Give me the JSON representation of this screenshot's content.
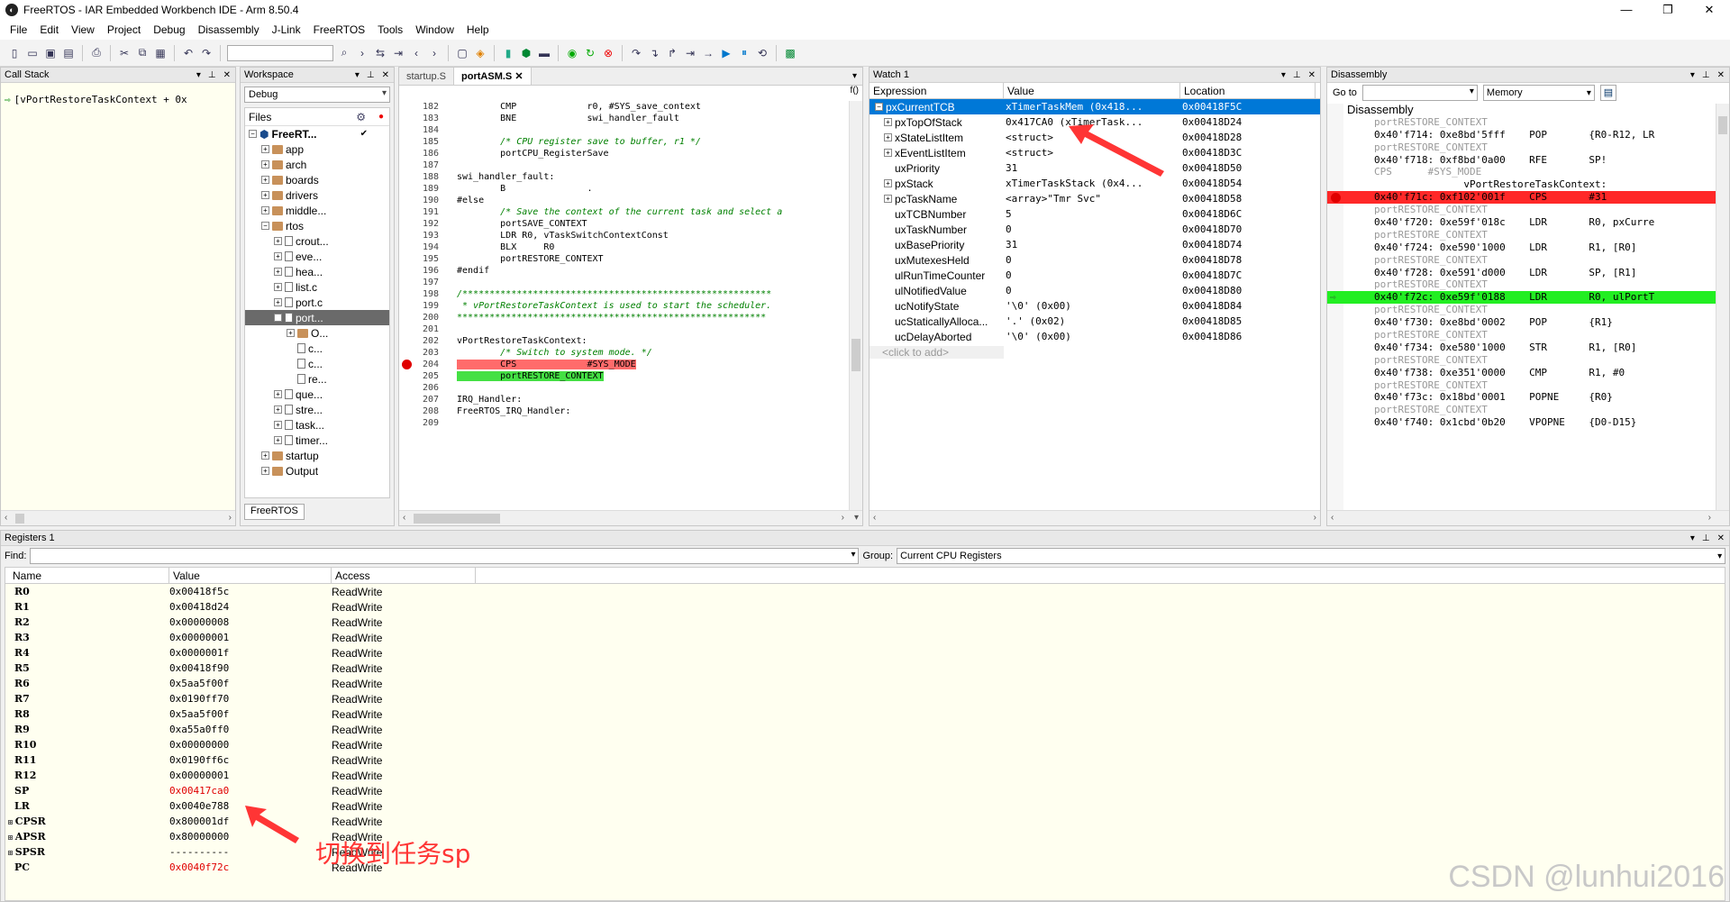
{
  "window": {
    "title": "FreeRTOS - IAR Embedded Workbench IDE - Arm 8.50.4"
  },
  "menu": [
    "File",
    "Edit",
    "View",
    "Project",
    "Debug",
    "Disassembly",
    "J-Link",
    "FreeRTOS",
    "Tools",
    "Window",
    "Help"
  ],
  "callstack": {
    "title": "Call Stack",
    "entry": "[vPortRestoreTaskContext + 0x"
  },
  "workspace": {
    "title": "Workspace",
    "config": "Debug",
    "files_header": "Files",
    "tab": "FreeRTOS",
    "tree": [
      {
        "label": "FreeRT...",
        "level": 0,
        "type": "proj",
        "exp": "⊟"
      },
      {
        "label": "app",
        "level": 1,
        "type": "folder",
        "exp": "⊞"
      },
      {
        "label": "arch",
        "level": 1,
        "type": "folder",
        "exp": "⊞"
      },
      {
        "label": "boards",
        "level": 1,
        "type": "folder",
        "exp": "⊞"
      },
      {
        "label": "drivers",
        "level": 1,
        "type": "folder",
        "exp": "⊞"
      },
      {
        "label": "middle...",
        "level": 1,
        "type": "folder",
        "exp": "⊞"
      },
      {
        "label": "rtos",
        "level": 1,
        "type": "folder",
        "exp": "⊟"
      },
      {
        "label": "crout...",
        "level": 2,
        "type": "file",
        "exp": "⊞"
      },
      {
        "label": "eve...",
        "level": 2,
        "type": "file",
        "exp": "⊞"
      },
      {
        "label": "hea...",
        "level": 2,
        "type": "file",
        "exp": "⊞"
      },
      {
        "label": "list.c",
        "level": 2,
        "type": "file",
        "exp": "⊞"
      },
      {
        "label": "port.c",
        "level": 2,
        "type": "file",
        "exp": "⊞"
      },
      {
        "label": "port...",
        "level": 2,
        "type": "file",
        "exp": "⊟",
        "sel": true
      },
      {
        "label": "O...",
        "level": 3,
        "type": "folder",
        "exp": "⊞"
      },
      {
        "label": "c...",
        "level": 3,
        "type": "file",
        "exp": ""
      },
      {
        "label": "c...",
        "level": 3,
        "type": "file",
        "exp": ""
      },
      {
        "label": "re...",
        "level": 3,
        "type": "file",
        "exp": ""
      },
      {
        "label": "que...",
        "level": 2,
        "type": "file",
        "exp": "⊞"
      },
      {
        "label": "stre...",
        "level": 2,
        "type": "file",
        "exp": "⊞"
      },
      {
        "label": "task...",
        "level": 2,
        "type": "file",
        "exp": "⊞"
      },
      {
        "label": "timer...",
        "level": 2,
        "type": "file",
        "exp": "⊞"
      },
      {
        "label": "startup",
        "level": 1,
        "type": "folder",
        "exp": "⊞"
      },
      {
        "label": "Output",
        "level": 1,
        "type": "folder",
        "exp": "⊞"
      }
    ]
  },
  "editor": {
    "tabs": [
      "startup.S",
      "portASM.S"
    ],
    "active_tab": "portASM.S",
    "func_glyph": "f()",
    "lines": [
      {
        "n": "182",
        "t": "        CMP             r0, #SYS_save_context"
      },
      {
        "n": "183",
        "t": "        BNE             swi_handler_fault"
      },
      {
        "n": "184",
        "t": ""
      },
      {
        "n": "185",
        "t": "        /* CPU register save to buffer, r1 */",
        "c": true
      },
      {
        "n": "186",
        "t": "        portCPU_RegisterSave"
      },
      {
        "n": "187",
        "t": ""
      },
      {
        "n": "188",
        "t": "swi_handler_fault:"
      },
      {
        "n": "189",
        "t": "        B               ."
      },
      {
        "n": "190",
        "t": "#else"
      },
      {
        "n": "191",
        "t": "        /* Save the context of the current task and select a",
        "c": true
      },
      {
        "n": "192",
        "t": "        portSAVE_CONTEXT"
      },
      {
        "n": "193",
        "t": "        LDR R0, vTaskSwitchContextConst"
      },
      {
        "n": "194",
        "t": "        BLX     R0"
      },
      {
        "n": "195",
        "t": "        portRESTORE_CONTEXT"
      },
      {
        "n": "196",
        "t": "#endif"
      },
      {
        "n": "197",
        "t": ""
      },
      {
        "n": "198",
        "t": "/*********************************************************",
        "c": true
      },
      {
        "n": "199",
        "t": " * vPortRestoreTaskContext is used to start the scheduler.",
        "c": true
      },
      {
        "n": "200",
        "t": "*********************************************************",
        "c": true
      },
      {
        "n": "201",
        "t": ""
      },
      {
        "n": "202",
        "t": "vPortRestoreTaskContext:"
      },
      {
        "n": "203",
        "t": "        /* Switch to system mode. */",
        "c": true
      },
      {
        "n": "204",
        "t": "        CPS             #SYS_MODE",
        "bp": true
      },
      {
        "n": "205",
        "t": "        portRESTORE_CONTEXT",
        "cur": true
      },
      {
        "n": "206",
        "t": ""
      },
      {
        "n": "207",
        "t": "IRQ_Handler:"
      },
      {
        "n": "208",
        "t": "FreeRTOS_IRQ_Handler:"
      },
      {
        "n": "209",
        "t": ""
      }
    ]
  },
  "watch": {
    "title": "Watch 1",
    "headers": [
      "Expression",
      "Value",
      "Location"
    ],
    "rows": [
      {
        "e": "pxCurrentTCB",
        "v": "xTimerTaskMem (0x418...",
        "l": "0x00418F5C",
        "exp": "⊟",
        "lvl": 0,
        "sel": true
      },
      {
        "e": "pxTopOfStack",
        "v": "0x417CA0 (xTimerTask...",
        "l": "0x00418D24",
        "exp": "⊞",
        "lvl": 1
      },
      {
        "e": "xStateListItem",
        "v": "<struct>",
        "l": "0x00418D28",
        "exp": "⊞",
        "lvl": 1
      },
      {
        "e": "xEventListItem",
        "v": "<struct>",
        "l": "0x00418D3C",
        "exp": "⊞",
        "lvl": 1
      },
      {
        "e": "uxPriority",
        "v": "31",
        "l": "0x00418D50",
        "exp": "",
        "lvl": 1
      },
      {
        "e": "pxStack",
        "v": "xTimerTaskStack (0x4...",
        "l": "0x00418D54",
        "exp": "⊞",
        "lvl": 1
      },
      {
        "e": "pcTaskName",
        "v": "<array>\"Tmr Svc\"",
        "l": "0x00418D58",
        "exp": "⊞",
        "lvl": 1
      },
      {
        "e": "uxTCBNumber",
        "v": "5",
        "l": "0x00418D6C",
        "exp": "",
        "lvl": 1
      },
      {
        "e": "uxTaskNumber",
        "v": "0",
        "l": "0x00418D70",
        "exp": "",
        "lvl": 1
      },
      {
        "e": "uxBasePriority",
        "v": "31",
        "l": "0x00418D74",
        "exp": "",
        "lvl": 1
      },
      {
        "e": "uxMutexesHeld",
        "v": "0",
        "l": "0x00418D78",
        "exp": "",
        "lvl": 1
      },
      {
        "e": "ulRunTimeCounter",
        "v": "0",
        "l": "0x00418D7C",
        "exp": "",
        "lvl": 1
      },
      {
        "e": "ulNotifiedValue",
        "v": "0",
        "l": "0x00418D80",
        "exp": "",
        "lvl": 1
      },
      {
        "e": "ucNotifyState",
        "v": "'\\0' (0x00)",
        "l": "0x00418D84",
        "exp": "",
        "lvl": 1
      },
      {
        "e": "ucStaticallyAlloca...",
        "v": "'.' (0x02)",
        "l": "0x00418D85",
        "exp": "",
        "lvl": 1
      },
      {
        "e": "ucDelayAborted",
        "v": "'\\0' (0x00)",
        "l": "0x00418D86",
        "exp": "",
        "lvl": 1
      }
    ],
    "click_to_add": "<click to add>"
  },
  "disassembly": {
    "title": "Disassembly",
    "goto_label": "Go to",
    "memory_option": "Memory",
    "header": "Disassembly",
    "lines": [
      {
        "t": "portRESTORE_CONTEXT",
        "k": "lbl"
      },
      {
        "t": "0x40'f714: 0xe8bd'5fff    POP       {R0-R12, LR"
      },
      {
        "t": "portRESTORE_CONTEXT",
        "k": "lbl"
      },
      {
        "t": "0x40'f718: 0xf8bd'0a00    RFE       SP!"
      },
      {
        "t": "CPS      #SYS_MODE",
        "k": "lbl"
      },
      {
        "t": "               vPortRestoreTaskContext:"
      },
      {
        "t": "0x40'f71c: 0xf102'001f    CPS       #31",
        "k": "bp"
      },
      {
        "t": "portRESTORE_CONTEXT",
        "k": "lbl"
      },
      {
        "t": "0x40'f720: 0xe59f'018c    LDR       R0, pxCurre"
      },
      {
        "t": "portRESTORE_CONTEXT",
        "k": "lbl"
      },
      {
        "t": "0x40'f724: 0xe590'1000    LDR       R1, [R0]"
      },
      {
        "t": "portRESTORE_CONTEXT",
        "k": "lbl"
      },
      {
        "t": "0x40'f728: 0xe591'd000    LDR       SP, [R1]"
      },
      {
        "t": "portRESTORE_CONTEXT",
        "k": "lbl"
      },
      {
        "t": "0x40'f72c: 0xe59f'0188    LDR       R0, ulPortT",
        "k": "cur"
      },
      {
        "t": "portRESTORE_CONTEXT",
        "k": "lbl"
      },
      {
        "t": "0x40'f730: 0xe8bd'0002    POP       {R1}"
      },
      {
        "t": "portRESTORE_CONTEXT",
        "k": "lbl"
      },
      {
        "t": "0x40'f734: 0xe580'1000    STR       R1, [R0]"
      },
      {
        "t": "portRESTORE_CONTEXT",
        "k": "lbl"
      },
      {
        "t": "0x40'f738: 0xe351'0000    CMP       R1, #0"
      },
      {
        "t": "portRESTORE_CONTEXT",
        "k": "lbl"
      },
      {
        "t": "0x40'f73c: 0x18bd'0001    POPNE     {R0}"
      },
      {
        "t": "portRESTORE_CONTEXT",
        "k": "lbl"
      },
      {
        "t": "0x40'f740: 0x1cbd'0b20    VPOPNE    {D0-D15}"
      }
    ]
  },
  "registers": {
    "title": "Registers 1",
    "find_label": "Find:",
    "group_label": "Group:",
    "group_value": "Current CPU Registers",
    "headers": [
      "Name",
      "Value",
      "Access"
    ],
    "rows": [
      {
        "n": "R0",
        "v": "0x00418f5c",
        "a": "ReadWrite"
      },
      {
        "n": "R1",
        "v": "0x00418d24",
        "a": "ReadWrite"
      },
      {
        "n": "R2",
        "v": "0x00000008",
        "a": "ReadWrite"
      },
      {
        "n": "R3",
        "v": "0x00000001",
        "a": "ReadWrite"
      },
      {
        "n": "R4",
        "v": "0x0000001f",
        "a": "ReadWrite"
      },
      {
        "n": "R5",
        "v": "0x00418f90",
        "a": "ReadWrite"
      },
      {
        "n": "R6",
        "v": "0x5aa5f00f",
        "a": "ReadWrite"
      },
      {
        "n": "R7",
        "v": "0x0190ff70",
        "a": "ReadWrite"
      },
      {
        "n": "R8",
        "v": "0x5aa5f00f",
        "a": "ReadWrite"
      },
      {
        "n": "R9",
        "v": "0xa55a0ff0",
        "a": "ReadWrite"
      },
      {
        "n": "R10",
        "v": "0x00000000",
        "a": "ReadWrite"
      },
      {
        "n": "R11",
        "v": "0x0190ff6c",
        "a": "ReadWrite"
      },
      {
        "n": "R12",
        "v": "0x00000001",
        "a": "ReadWrite"
      },
      {
        "n": "SP",
        "v": "0x00417ca0",
        "a": "ReadWrite",
        "chg": true
      },
      {
        "n": "LR",
        "v": "0x0040e788",
        "a": "ReadWrite"
      },
      {
        "n": "CPSR",
        "v": "0x800001df",
        "a": "ReadWrite",
        "exp": true
      },
      {
        "n": "APSR",
        "v": "0x80000000",
        "a": "ReadWrite",
        "exp": true
      },
      {
        "n": "SPSR",
        "v": "----------",
        "a": "ReadWrite",
        "exp": true
      },
      {
        "n": "PC",
        "v": "0x0040f72c",
        "a": "ReadWrite",
        "chg": true
      }
    ]
  },
  "annotation": "切换到任务sp",
  "watermark": "CSDN @lunhui2016"
}
